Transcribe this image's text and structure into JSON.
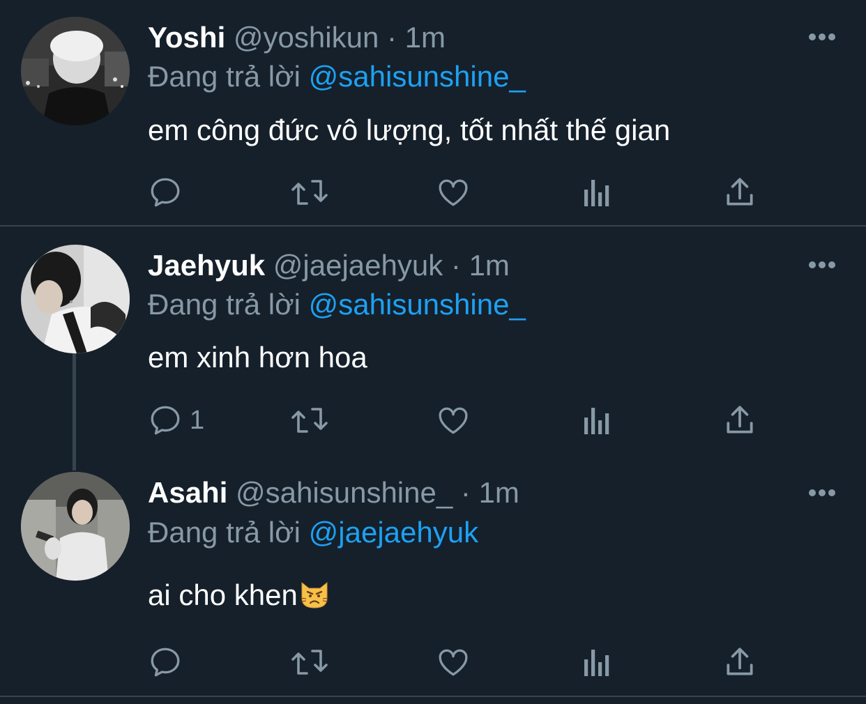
{
  "tweets": [
    {
      "name": "Yoshi",
      "handle": "@yoshikun",
      "dot": "·",
      "time": "1m",
      "reply_prefix": "Đang trả lời",
      "reply_to": "@sahisunshine_",
      "text": "em công đức vô lượng, tốt nhất thế gian",
      "reply_count": "",
      "avatar_icon": "avatar-photo"
    },
    {
      "name": "Jaehyuk",
      "handle": "@jaejaehyuk",
      "dot": "·",
      "time": "1m",
      "reply_prefix": "Đang trả lời",
      "reply_to": "@sahisunshine_",
      "text": "em xinh hơn hoa",
      "reply_count": "1",
      "avatar_icon": "avatar-photo"
    },
    {
      "name": "Asahi",
      "handle": "@sahisunshine_",
      "dot": "·",
      "time": "1m",
      "reply_prefix": "Đang trả lời",
      "reply_to": "@jaejaehyuk",
      "text": "ai cho khen",
      "emoji": "pouting-cat-face",
      "reply_count": "",
      "avatar_icon": "avatar-photo"
    }
  ],
  "colors": {
    "background": "#15202b",
    "divider": "#38444d",
    "secondary_text": "#8899a6",
    "mention": "#1da1f2",
    "primary_text": "#ffffff"
  },
  "action_icons": [
    "reply-icon",
    "retweet-icon",
    "like-icon",
    "analytics-icon",
    "share-icon"
  ]
}
